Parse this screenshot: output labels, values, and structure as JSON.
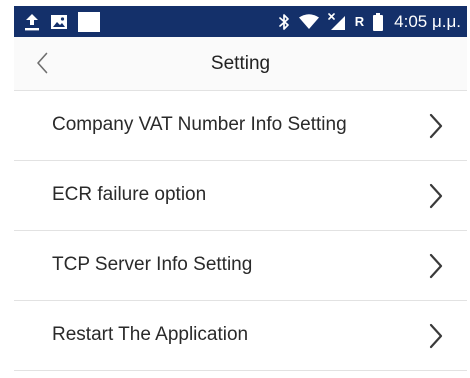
{
  "status_bar": {
    "left_icons": [
      "upload-icon",
      "image-icon",
      "blank-notification-icon"
    ],
    "right_icons": [
      "bluetooth-icon",
      "wifi-icon",
      "no-signal-icon",
      "battery-icon"
    ],
    "roaming_indicator": "R",
    "time": "4:05 μ.μ.",
    "background_color": "#14306a"
  },
  "header": {
    "back_icon": "chevron-left-icon",
    "title": "Setting"
  },
  "menu": {
    "items": [
      {
        "label": "Company VAT Number Info Setting",
        "icon": "chevron-right-icon"
      },
      {
        "label": "ECR failure option",
        "icon": "chevron-right-icon"
      },
      {
        "label": "TCP Server Info Setting",
        "icon": "chevron-right-icon"
      },
      {
        "label": "Restart The Application",
        "icon": "chevron-right-icon"
      }
    ]
  }
}
